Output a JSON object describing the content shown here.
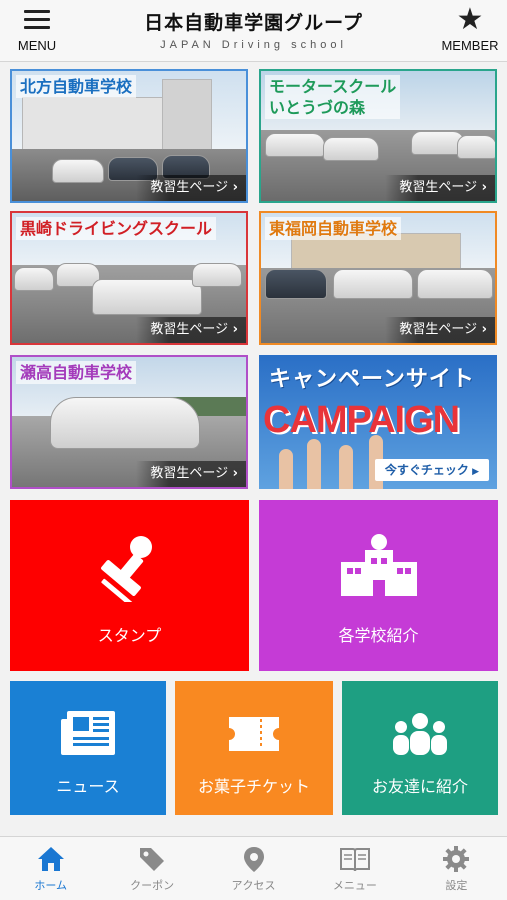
{
  "header": {
    "menu_label": "MENU",
    "title": "日本自動車学園グループ",
    "subtitle": "JAPAN Driving school",
    "member_label": "MEMBER"
  },
  "schools": [
    {
      "name": "北方自動車学校",
      "link": "教習生ページ",
      "border": "#4a90d9",
      "name_color": "#1a6fc0"
    },
    {
      "name": "モータースクール\nいとうづの森",
      "link": "教習生ページ",
      "border": "#2aa58c",
      "name_color": "#1e9a5a"
    },
    {
      "name": "黒崎ドライビングスクール",
      "link": "教習生ページ",
      "border": "#d9363a",
      "name_color": "#d11f25"
    },
    {
      "name": "東福岡自動車学校",
      "link": "教習生ページ",
      "border": "#f08a24",
      "name_color": "#e07a10"
    },
    {
      "name": "瀬高自動車学校",
      "link": "教習生ページ",
      "border": "#b04fc8",
      "name_color": "#a43bbb"
    }
  ],
  "campaign": {
    "title": "キャンペーンサイト",
    "banner": "CAMPAIGN",
    "button": "今すぐチェック"
  },
  "tiles": {
    "stamp": {
      "label": "スタンプ",
      "color": "#fe0000"
    },
    "schools": {
      "label": "各学校紹介",
      "color": "#c53bd6"
    },
    "news": {
      "label": "ニュース",
      "color": "#1a80d4"
    },
    "tickets": {
      "label": "お菓子チケット",
      "color": "#f98921"
    },
    "refer": {
      "label": "お友達に紹介",
      "color": "#1e9f82"
    }
  },
  "bottom_nav": [
    {
      "label": "ホーム",
      "icon": "home-icon",
      "active": true
    },
    {
      "label": "クーポン",
      "icon": "tag-icon",
      "active": false
    },
    {
      "label": "アクセス",
      "icon": "location-pin-icon",
      "active": false
    },
    {
      "label": "メニュー",
      "icon": "book-icon",
      "active": false
    },
    {
      "label": "設定",
      "icon": "gear-icon",
      "active": false
    }
  ],
  "colors": {
    "accent": "#1a77d2",
    "nav_inactive": "#888888"
  }
}
